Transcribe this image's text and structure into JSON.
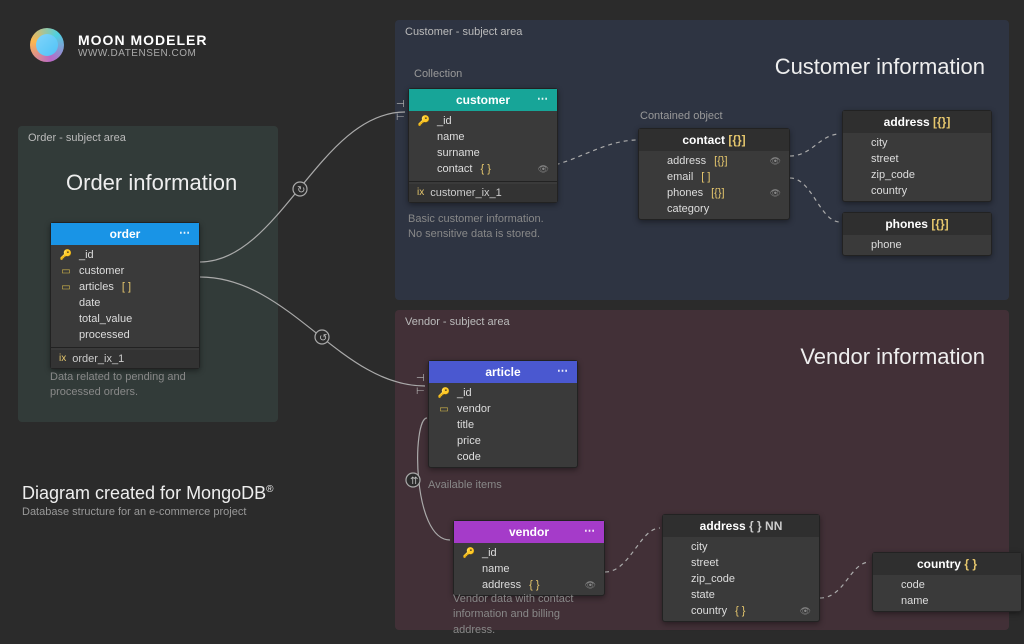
{
  "brand": {
    "title": "MOON MODELER",
    "subtitle": "WWW.DATENSEN.COM"
  },
  "footer": {
    "big": "Diagram created for MongoDB",
    "sup": "®",
    "small": "Database structure for an e-commerce project"
  },
  "areas": {
    "order": {
      "label": "Order - subject area",
      "title": "Order information"
    },
    "customer": {
      "label": "Customer - subject area",
      "title": "Customer information",
      "section_collection": "Collection",
      "section_contained": "Contained object"
    },
    "vendor": {
      "label": "Vendor - subject area",
      "title": "Vendor information"
    }
  },
  "entities": {
    "order": {
      "name": "order",
      "fields": [
        {
          "icon": "key",
          "name": "_id"
        },
        {
          "icon": "ref",
          "name": "customer"
        },
        {
          "icon": "ref",
          "name": "articles",
          "suffix": "[ ]"
        },
        {
          "name": "date"
        },
        {
          "name": "total_value"
        },
        {
          "name": "processed"
        }
      ],
      "index": "order_ix_1",
      "caption": "Data related to pending and\nprocessed orders."
    },
    "customer": {
      "name": "customer",
      "fields": [
        {
          "icon": "key",
          "name": "_id"
        },
        {
          "name": "name"
        },
        {
          "name": "surname"
        },
        {
          "name": "contact",
          "suffix": "{ }",
          "eye": true
        }
      ],
      "index": "customer_ix_1",
      "caption": "Basic customer information.\nNo sensitive data is stored."
    },
    "contact": {
      "name": "contact",
      "suffix": "[{}]",
      "fields": [
        {
          "name": "address",
          "suffix": "[{}]",
          "eye": true
        },
        {
          "name": "email",
          "suffix": "[ ]"
        },
        {
          "name": "phones",
          "suffix": "[{}]",
          "eye": true
        },
        {
          "name": "category"
        }
      ]
    },
    "address_cust": {
      "name": "address",
      "suffix": "[{}]",
      "fields": [
        {
          "name": "city"
        },
        {
          "name": "street"
        },
        {
          "name": "zip_code"
        },
        {
          "name": "country"
        }
      ]
    },
    "phones": {
      "name": "phones",
      "suffix": "[{}]",
      "fields": [
        {
          "name": "phone"
        }
      ]
    },
    "article": {
      "name": "article",
      "fields": [
        {
          "icon": "key",
          "name": "_id"
        },
        {
          "icon": "ref",
          "name": "vendor"
        },
        {
          "name": "title"
        },
        {
          "name": "price"
        },
        {
          "name": "code"
        }
      ],
      "caption": "Available items"
    },
    "vendor": {
      "name": "vendor",
      "fields": [
        {
          "icon": "key",
          "name": "_id"
        },
        {
          "name": "name"
        },
        {
          "name": "address",
          "suffix": "{ }",
          "eye": true
        }
      ],
      "caption": "Vendor data with contact\ninformation and billing\naddress."
    },
    "address_vend": {
      "name": "address",
      "suffix": "{ } NN",
      "fields": [
        {
          "name": "city"
        },
        {
          "name": "street"
        },
        {
          "name": "zip_code"
        },
        {
          "name": "state"
        },
        {
          "name": "country",
          "suffix": "{ }",
          "eye": true
        }
      ]
    },
    "country": {
      "name": "country",
      "suffix": "{ }",
      "fields": [
        {
          "name": "code"
        },
        {
          "name": "name"
        }
      ]
    }
  }
}
